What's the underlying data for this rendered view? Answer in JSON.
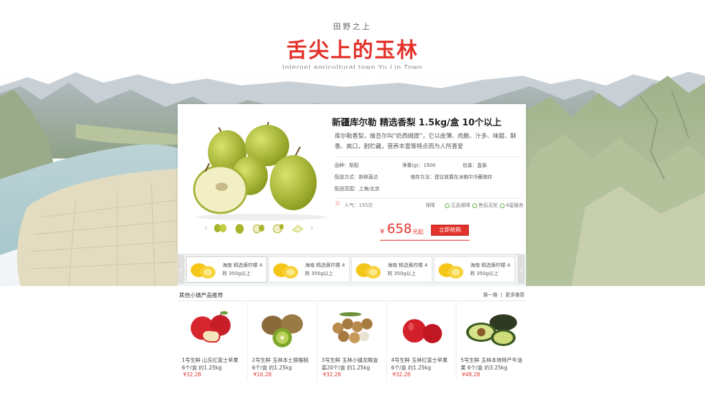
{
  "header": {
    "tagline": "田野之上",
    "title": "舌尖上的玉林",
    "subtitle": "Internet agricultural town  Yu Lin Town"
  },
  "product": {
    "title": "新疆库尔勒 精选香梨 1.5kg/盒 10个以上",
    "description": "库尔勒香梨，维吾尔叫“奶西姆提”，它以皮薄、肉脆、汁多、味甜、酥香、爽口，耐贮藏，营养丰富等特点而为人所喜爱",
    "specs": {
      "variety": "品种：梨配",
      "net_weight": "净重(g)：1500",
      "packaging": "包装：盒装",
      "shipping": "配送方式：新鲜直达",
      "storage": "储存方法：建议放置在冰箱中冷藏储存",
      "delivery_area": "配送范围：上海/北京"
    },
    "popularity": "人气：155次",
    "guarantee_label": "保障",
    "badges": [
      "正品保障",
      "售后无忧",
      "8星服务"
    ],
    "currency": "¥",
    "price": "658",
    "price_suffix": "元起",
    "buy_label": "立即抢购"
  },
  "thumb_nav": {
    "prev": "‹",
    "next": "›"
  },
  "related": {
    "prev": "‹",
    "next": "›",
    "items": [
      {
        "line1": "海南 精选黄柠檬 4",
        "line2": "枚 350g以上"
      },
      {
        "line1": "海南 精选黄柠檬 4",
        "line2": "枚 350g以上"
      },
      {
        "line1": "海南 精选黄柠檬 4",
        "line2": "枚 350g以上"
      },
      {
        "line1": "海南 精选黄柠檬 4",
        "line2": "枚 350g以上"
      }
    ]
  },
  "recommend": {
    "title": "其他小镇产品推荐",
    "refresh": "换一换",
    "more": "更多推荐",
    "items": [
      {
        "line1": "1号生鲜  山东红富士苹果",
        "line2": "6个/盒 约1.25kg",
        "price": "¥32.28"
      },
      {
        "line1": "2号生鲜  玉林本土猕猴桃",
        "line2": "6个/盒 约1.25kg",
        "price": "¥16.28"
      },
      {
        "line1": "3号生鲜  玉林小镇龙眼盒",
        "line2": "装20个/盒 约1.25kg",
        "price": "¥32.28"
      },
      {
        "line1": "4号生鲜  玉林红富士苹果",
        "line2": "6个/盒 约1.25kg",
        "price": "¥32.28"
      },
      {
        "line1": "5号生鲜  玉林本地特产牛油",
        "line2": "果 6个/盒 约3.25kg",
        "price": "¥48.28"
      }
    ]
  },
  "colors": {
    "accent": "#e3322b",
    "text": "#333333",
    "muted": "#888888"
  },
  "icons": [
    "star-icon",
    "check-icon",
    "chevron-left-icon",
    "chevron-right-icon"
  ]
}
